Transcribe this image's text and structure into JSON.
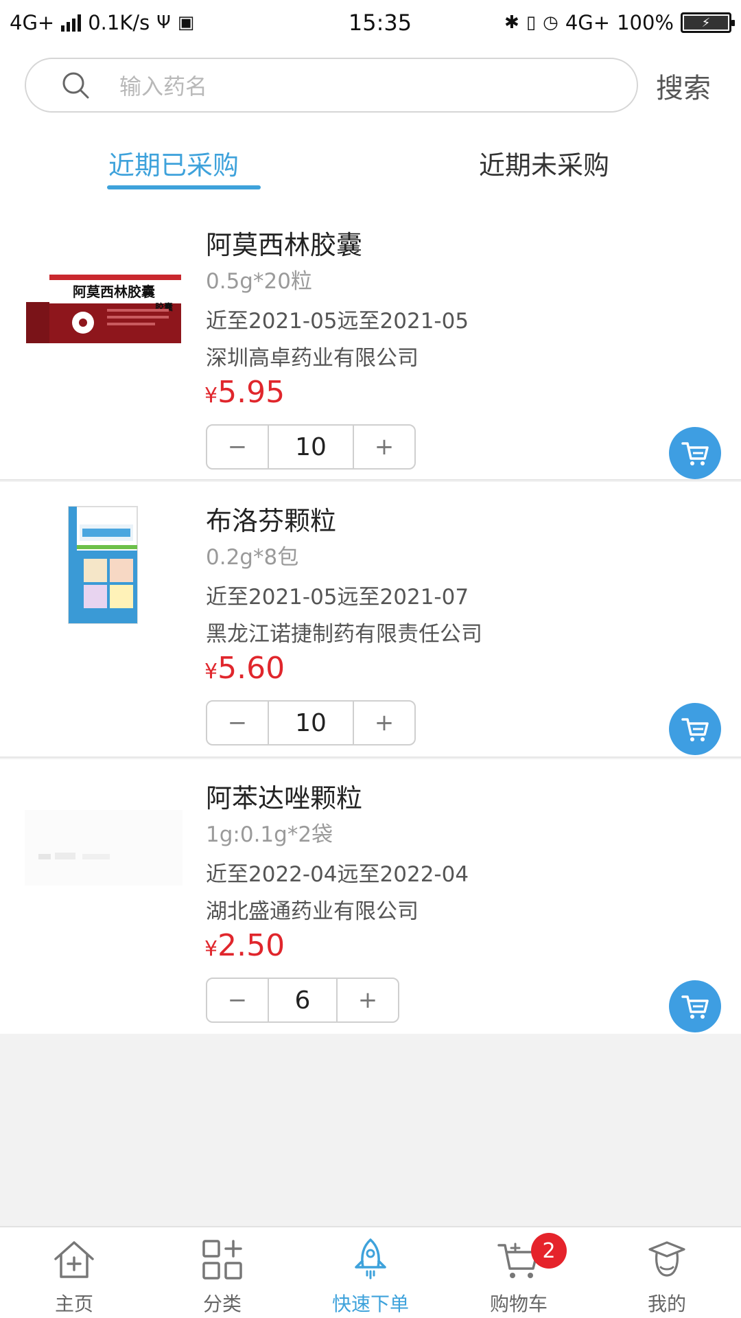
{
  "status_bar": {
    "network": "4G+",
    "speed": "0.1K/s",
    "time": "15:35",
    "network_right": "4G+",
    "battery": "100%"
  },
  "search": {
    "placeholder": "输入药名",
    "button_label": "搜索"
  },
  "tabs": [
    {
      "label": "近期已采购",
      "active": true
    },
    {
      "label": "近期未采购",
      "active": false
    }
  ],
  "products": [
    {
      "name": "阿莫西林胶囊",
      "spec": "0.5g*20粒",
      "expiry": "近至2021-05远至2021-05",
      "manufacturer": "深圳高卓药业有限公司",
      "currency": "¥",
      "price": "5.95",
      "quantity": "10",
      "image_text": "阿莫西林胶囊",
      "image_side_text": "胶囊"
    },
    {
      "name": "布洛芬颗粒",
      "spec": "0.2g*8包",
      "expiry": "近至2021-05远至2021-07",
      "manufacturer": "黑龙江诺捷制药有限责任公司",
      "currency": "¥",
      "price": "5.60",
      "quantity": "10"
    },
    {
      "name": "阿苯达唑颗粒",
      "spec": "1g:0.1g*2袋",
      "expiry": "近至2022-04远至2022-04",
      "manufacturer": "湖北盛通药业有限公司",
      "currency": "¥",
      "price": "2.50",
      "quantity": "6"
    }
  ],
  "stepper": {
    "minus": "−",
    "plus": "+"
  },
  "bottom_nav": [
    {
      "label": "主页",
      "icon": "home-icon"
    },
    {
      "label": "分类",
      "icon": "category-icon"
    },
    {
      "label": "快速下单",
      "icon": "rocket-icon",
      "active": true
    },
    {
      "label": "购物车",
      "icon": "cart-icon",
      "badge": "2"
    },
    {
      "label": "我的",
      "icon": "profile-icon"
    }
  ],
  "colors": {
    "accent": "#3ea2db",
    "price": "#e0262c",
    "cart_button": "#3e9ee2",
    "badge": "#e5232b"
  }
}
